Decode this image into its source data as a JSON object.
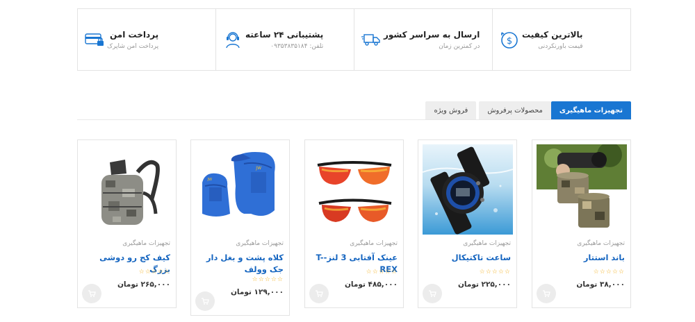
{
  "colors": {
    "accent": "#1976d2",
    "link": "#1565c0",
    "star": "#f2b01e"
  },
  "features": [
    {
      "icon": "dollar-coin-icon",
      "title": "بالاترین کیفیت",
      "subtitle": "قیمت باورنکردنی"
    },
    {
      "icon": "delivery-truck-icon",
      "title": "ارسال به سراسر کشور",
      "subtitle": "در کمترین زمان"
    },
    {
      "icon": "support-headset-icon",
      "title": "پشتیبانی ۲۴ ساعته",
      "subtitle": "تلفن: ۰۹۳۵۳۸۳۵۱۸۴"
    },
    {
      "icon": "secure-card-icon",
      "title": "پرداخت امن",
      "subtitle": "پرداخت امن شاپرک"
    }
  ],
  "tabs": [
    {
      "label": "تجهیزات ماهیگیری",
      "active": true
    },
    {
      "label": "محصولات پرفروش",
      "active": false
    },
    {
      "label": "فروش ویژه",
      "active": false
    }
  ],
  "products": [
    {
      "category": "تجهیزات ماهیگیری",
      "title": "باند استتار",
      "stars": "☆☆☆☆☆",
      "price": "۳۸,۰۰۰ تومان",
      "image": "camo-tape-photo"
    },
    {
      "category": "تجهیزات ماهیگیری",
      "title": "ساعت تاکتیکال",
      "stars": "☆☆☆☆☆",
      "price": "۲۲۵,۰۰۰ تومان",
      "image": "tactical-watch-photo"
    },
    {
      "category": "تجهیزات ماهیگیری",
      "title": "عینک آفتابی 3 لنز-T-REX",
      "stars": "☆☆☆☆☆",
      "price": "۴۸۵,۰۰۰ تومان",
      "image": "sunglasses-photo"
    },
    {
      "category": "تجهیزات ماهیگیری",
      "title": "کلاه پشت و بغل دار جک وولف",
      "stars": "☆☆☆☆☆",
      "price": "۱۲۹,۰۰۰ تومان",
      "image": "blue-cap-photo"
    },
    {
      "category": "تجهیزات ماهیگیری",
      "title": "کیف کج رو دوشی بزرگ",
      "stars": "☆☆☆☆☆",
      "price": "۲۶۵,۰۰۰ تومان",
      "image": "camo-bag-photo"
    }
  ]
}
